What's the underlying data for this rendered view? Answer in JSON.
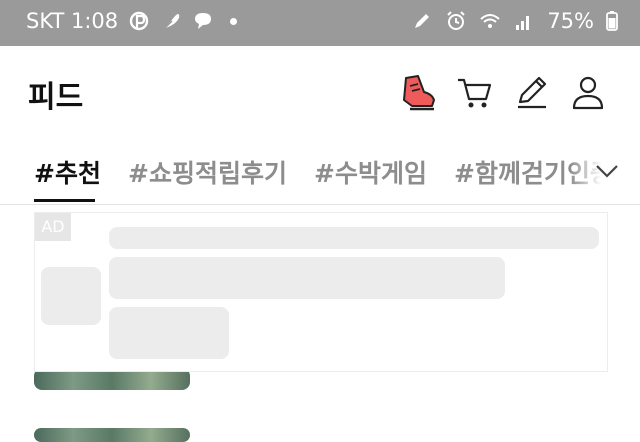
{
  "status_bar": {
    "carrier_time": "SKT 1:08",
    "battery": "75%",
    "icons_left": [
      "pay-icon",
      "feather-icon",
      "chat-bubble-icon",
      "notification-dot"
    ],
    "icons_right": [
      "pen-icon",
      "alarm-icon",
      "wifi-6-icon",
      "signal-icon",
      "battery-icon"
    ]
  },
  "header": {
    "title": "피드",
    "icons": [
      "sneaker-icon",
      "cart-icon",
      "pencil-icon",
      "profile-icon"
    ]
  },
  "tabs": {
    "items": [
      "#추천",
      "#쇼핑적립후기",
      "#수박게임",
      "#함께걷기인증"
    ],
    "active_index": 0,
    "expand_icon": "chevron-down-icon"
  },
  "ad": {
    "badge": "AD"
  },
  "colors": {
    "status_bar_bg": "#9a9a9a",
    "active_tab": "#111111",
    "inactive_tab": "#8d8d8d",
    "sneaker_red": "#ef5b5b",
    "placeholder": "#ececec"
  }
}
